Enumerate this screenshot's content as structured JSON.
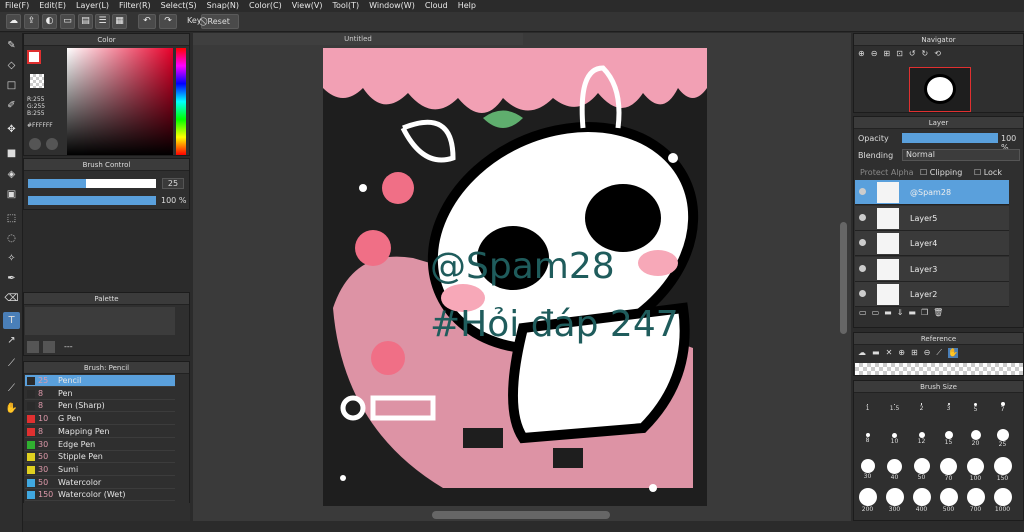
{
  "menu": [
    "File(F)",
    "Edit(E)",
    "Layer(L)",
    "Filter(R)",
    "Select(S)",
    "Snap(N)",
    "Color(C)",
    "View(V)",
    "Tool(T)",
    "Window(W)",
    "Cloud",
    "Help"
  ],
  "toolbar": {
    "key_label": "Key",
    "reset_label": "Reset"
  },
  "document": {
    "title": "Untitled"
  },
  "color_panel": {
    "title": "Color",
    "r": "R:255",
    "g": "G:255",
    "b": "B:255",
    "hex": "#FFFFFF"
  },
  "brush_control": {
    "title": "Brush Control",
    "size": "25",
    "opacity": "100 %",
    "size_fraction": 0.45,
    "opacity_fraction": 1.0
  },
  "palette": {
    "title": "Palette",
    "footer": "---"
  },
  "brush_list": {
    "title": "Brush: Pencil",
    "items": [
      {
        "size": "25",
        "name": "Pencil",
        "color": "#2a2a2a"
      },
      {
        "size": "8",
        "name": "Pen",
        "color": "#2a2a2a"
      },
      {
        "size": "8",
        "name": "Pen (Sharp)",
        "color": "#2a2a2a"
      },
      {
        "size": "10",
        "name": "G Pen",
        "color": "#e03030"
      },
      {
        "size": "8",
        "name": "Mapping Pen",
        "color": "#e03030"
      },
      {
        "size": "30",
        "name": "Edge Pen",
        "color": "#30b030"
      },
      {
        "size": "50",
        "name": "Stipple Pen",
        "color": "#e0d020"
      },
      {
        "size": "30",
        "name": "Sumi",
        "color": "#e0d020"
      },
      {
        "size": "50",
        "name": "Watercolor",
        "color": "#40a8e0"
      },
      {
        "size": "150",
        "name": "Watercolor (Wet)",
        "color": "#40a8e0"
      }
    ]
  },
  "navigator": {
    "title": "Navigator"
  },
  "layer_panel": {
    "title": "Layer",
    "opacity_label": "Opacity",
    "opacity_value": "100 %",
    "blending_label": "Blending",
    "blending_value": "Normal",
    "protect_alpha": "Protect Alpha",
    "clipping": "Clipping",
    "lock": "Lock",
    "layers": [
      "@Spam28",
      "Layer5",
      "Layer4",
      "Layer3",
      "Layer2"
    ]
  },
  "reference": {
    "title": "Reference"
  },
  "brush_size": {
    "title": "Brush Size",
    "sizes": [
      "1",
      "1.5",
      "2",
      "3",
      "5",
      "7",
      "8",
      "10",
      "12",
      "15",
      "20",
      "25",
      "30",
      "40",
      "50",
      "70",
      "100",
      "150",
      "200",
      "300",
      "400",
      "500",
      "700",
      "1000"
    ]
  },
  "watermark": {
    "line1": "@Spam28",
    "line2": "#Hỏi đáp 247"
  },
  "colors": {
    "accent": "#5aa0dc",
    "canvas_bg": "#1e1e1e",
    "pink": "#f2a0b4"
  }
}
